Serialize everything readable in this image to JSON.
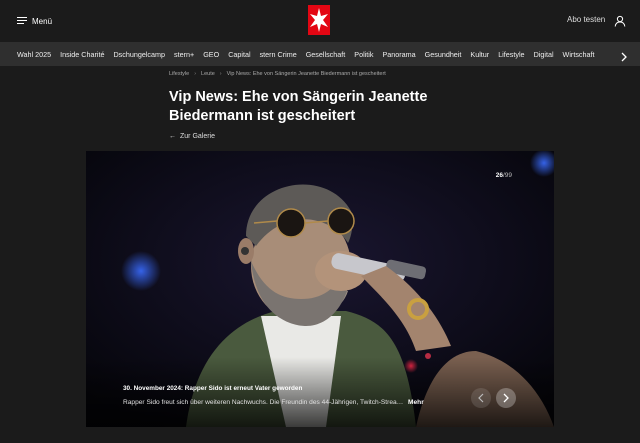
{
  "header": {
    "menu_label": "Menü",
    "abo_label": "Abo testen",
    "brand_color": "#e30613"
  },
  "nav": {
    "items": [
      "Wahl 2025",
      "Inside Charité",
      "Dschungelcamp",
      "stern+",
      "GEO",
      "Capital",
      "stern Crime",
      "Gesellschaft",
      "Politik",
      "Panorama",
      "Gesundheit",
      "Kultur",
      "Lifestyle",
      "Digital",
      "Wirtschaft"
    ]
  },
  "breadcrumb": {
    "items": [
      "Lifestyle",
      "Leute",
      "Vip News: Ehe von Sängerin Jeanette Biedermann ist gescheitert"
    ]
  },
  "article": {
    "title": "Vip News: Ehe von Sängerin Jeanette Biedermann ist gescheitert",
    "back_label": "Zur Galerie"
  },
  "gallery": {
    "current": "26",
    "total": "/99",
    "caption_title": "30. November 2024: Rapper Sido ist erneut Vater geworden",
    "caption_text": "Rapper Sido freut sich über weiteren Nachwuchs. Die Freundin des 44-Jährigen, Twitch-Streamerin, hat ein Kind zur Welt gebracht.",
    "more_label": "Mehr"
  },
  "icons": {
    "menu": "hamburger-icon",
    "user": "user-icon",
    "nav_next": "chevron-right-icon",
    "back": "arrow-left-icon",
    "prev": "chevron-left-icon",
    "next": "chevron-right-icon"
  }
}
